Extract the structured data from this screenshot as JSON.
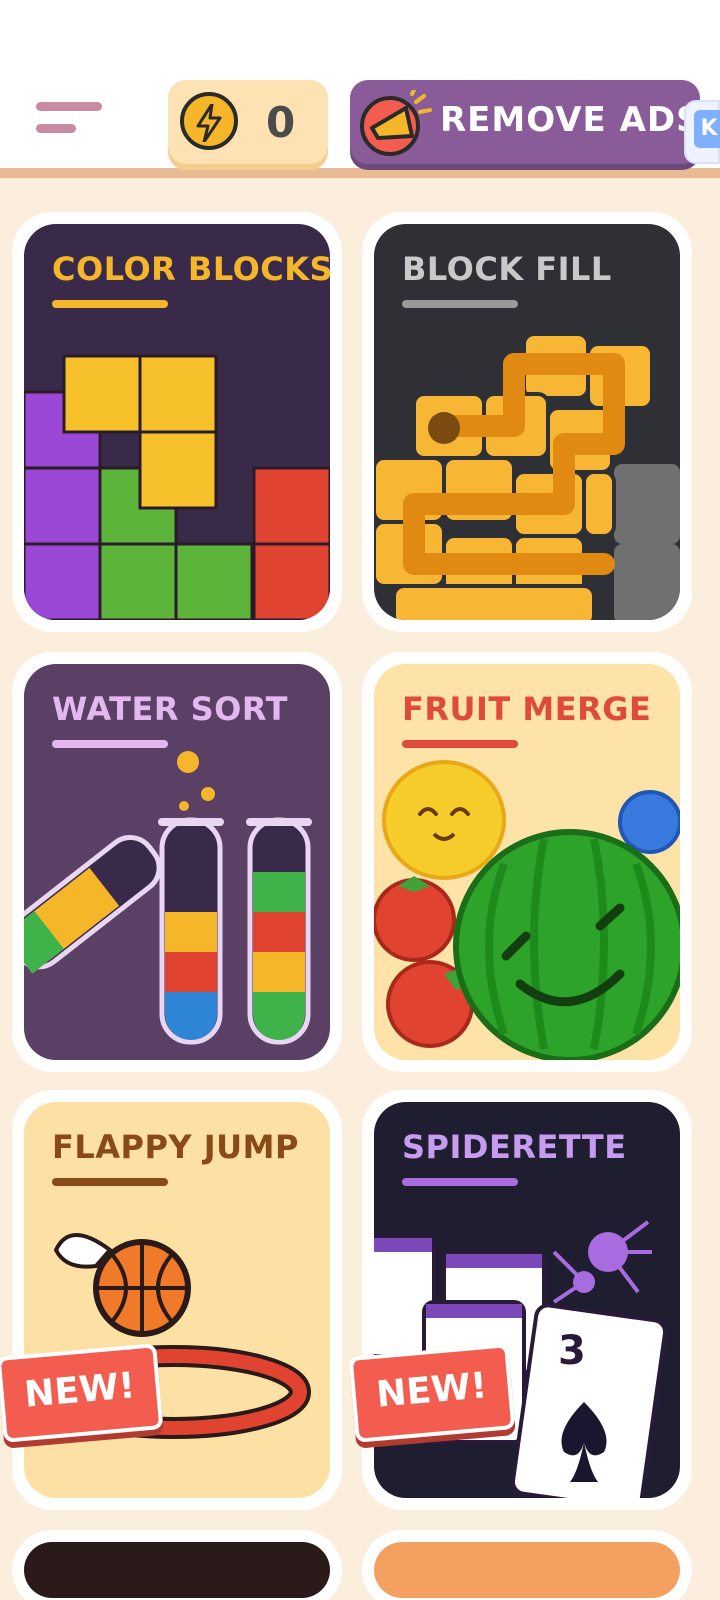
{
  "header": {
    "menu_icon": "hamburger-menu-icon",
    "coins": {
      "icon": "lightning-coin-icon",
      "count": "0"
    },
    "remove_ads": {
      "icon": "megaphone-icon",
      "label": "REMOVE ADS"
    },
    "keyboard_badge": "K"
  },
  "games": [
    {
      "title": "COLOR BLOCKS",
      "title_color": "#f6b62a",
      "bg": "#3a2a4a"
    },
    {
      "title": "BLOCK FILL",
      "title_color": "#c9c9c9",
      "bg": "#2e3036"
    },
    {
      "title": "WATER SORT",
      "title_color": "#e3b8f0",
      "bg": "#5a4064"
    },
    {
      "title": "FRUIT MERGE",
      "title_color": "#e04a3b",
      "bg": "#fde3a8"
    },
    {
      "title": "FLAPPY JUMP",
      "title_color": "#8a4a18",
      "bg": "#fde0a4",
      "badge": "NEW!"
    },
    {
      "title": "SPIDERETTE",
      "title_color": "#c79cf0",
      "bg": "#1f1d30",
      "badge": "NEW!"
    }
  ],
  "partial_cards": [
    {
      "bg": "#2a1a1a"
    },
    {
      "bg": "#f4a060"
    }
  ]
}
